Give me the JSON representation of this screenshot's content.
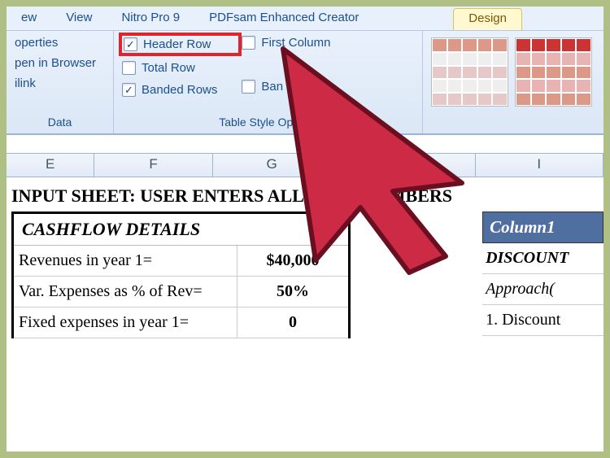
{
  "tabs": {
    "t1_partial": "ew",
    "view": "View",
    "nitro": "Nitro Pro 9",
    "pdfsam": "PDFsam Enhanced Creator",
    "design": "Design"
  },
  "ext": {
    "properties": "operties",
    "openbrowser": "pen in Browser",
    "link": "ilink",
    "group": "Data"
  },
  "options": {
    "header_row": "Header Row",
    "total_row": "Total Row",
    "banded_rows": "Banded Rows",
    "first_column": "First Column",
    "last_column_partial": "",
    "banded_partial": "Ban",
    "group": "Table Style Options"
  },
  "columns": {
    "E": "E",
    "F": "F",
    "G": "G",
    "I": "I"
  },
  "sheet": {
    "title": "INPUT SHEET: USER ENTERS ALL BOLD NUMBERS",
    "cashflow_header": "CASHFLOW DETAILS",
    "rows": [
      {
        "label": "Revenues in  year 1=",
        "value": "$40,000"
      },
      {
        "label": "Var. Expenses as % of Rev=",
        "value": "50%"
      },
      {
        "label": "Fixed expenses in year 1=",
        "value": "0"
      }
    ],
    "right": {
      "header": "Column1",
      "r1": "DISCOUNT",
      "r2": "Approach(",
      "r3": "1. Discount"
    }
  }
}
